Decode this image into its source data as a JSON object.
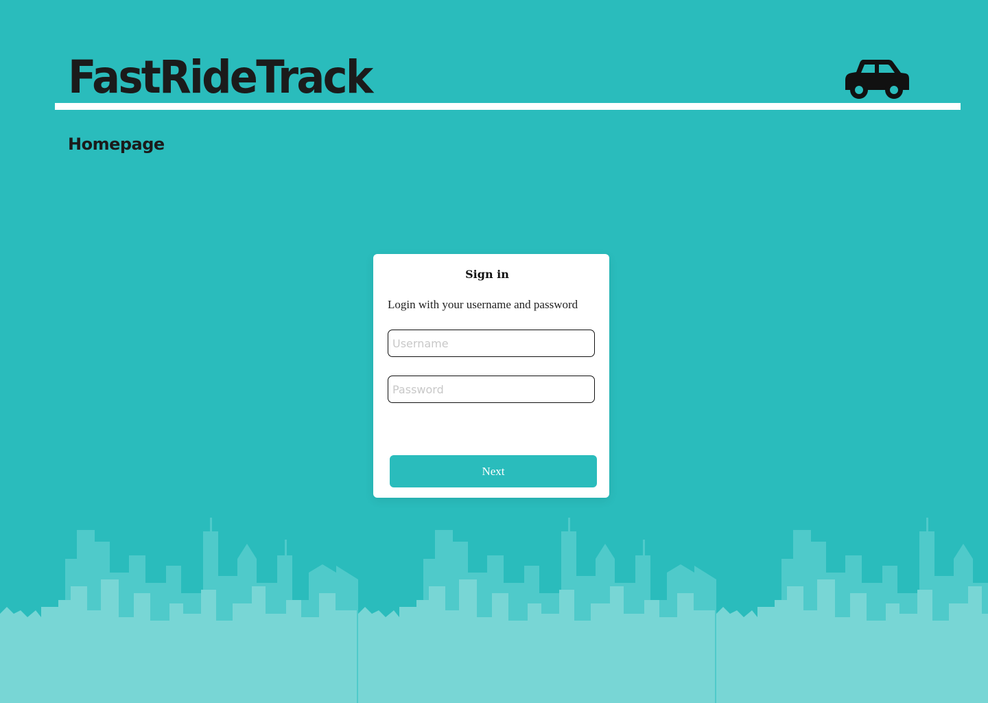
{
  "header": {
    "app_title": "FastRideTrack",
    "car_icon": "car-icon"
  },
  "page": {
    "title": "Homepage"
  },
  "login": {
    "title": "Sign in",
    "subtitle": "Login with your username and password",
    "username_placeholder": "Username",
    "username_value": "",
    "password_placeholder": "Password",
    "password_value": "",
    "next_label": "Next"
  },
  "colors": {
    "background": "#2abcbc",
    "accent": "#2abcbc",
    "skyline_back": "#4fcaca",
    "skyline_front": "#78d6d5",
    "title_text": "#1b1b1b",
    "card_background": "#ffffff"
  }
}
